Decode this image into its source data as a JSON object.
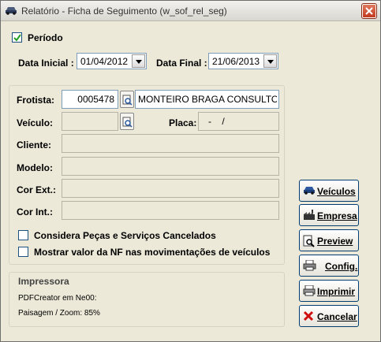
{
  "window": {
    "title": "Relatório - Ficha de Seguimento (w_sof_rel_seg)"
  },
  "periodo": {
    "checkbox_label": "Período",
    "checked": true,
    "data_inicial_label": "Data Inicial :",
    "data_inicial_value": "01/04/2012",
    "data_final_label": "Data Final :",
    "data_final_value": "21/06/2013"
  },
  "form": {
    "frotista_label": "Frotista:",
    "frotista_code": "0005478",
    "frotista_name": "MONTEIRO BRAGA CONSULTOR",
    "veiculo_label": "Veículo:",
    "veiculo_value": "",
    "placa_label": "Placa:",
    "placa_value": "-    /",
    "cliente_label": "Cliente:",
    "cliente_value": "",
    "modelo_label": "Modelo:",
    "modelo_value": "",
    "cor_ext_label": "Cor Ext.:",
    "cor_ext_value": "",
    "cor_int_label": "Cor Int.:",
    "cor_int_value": "",
    "considera_label": "Considera Peças e Serviços Cancelados",
    "considera_checked": false,
    "mostrar_label": "Mostrar valor da NF nas movimentações de veículos",
    "mostrar_checked": false
  },
  "impressora": {
    "title": "Impressora",
    "printer": "PDFCreator em Ne00:",
    "layout": "Paisagem / Zoom: 85%"
  },
  "buttons": {
    "veiculos": "Veículos",
    "empresa": "Empresa",
    "preview": "Preview",
    "config": "Config.",
    "imprimir": "Imprimir",
    "cancelar": "Cancelar"
  },
  "icons": {
    "title": "car-icon",
    "close": "close-icon",
    "veiculos": "car-icon",
    "empresa": "factory-icon",
    "preview": "magnifier-page-icon",
    "config": "printer-config-icon",
    "imprimir": "printer-icon",
    "cancelar": "red-x-icon",
    "picker": "search-document-icon"
  },
  "colors": {
    "window_bg": "#ece9d8",
    "titlebar": "#e6e4de",
    "close_red": "#c23a1e",
    "check_green": "#21a121",
    "field_border": "#7f9db9",
    "button_border": "#003c74"
  }
}
